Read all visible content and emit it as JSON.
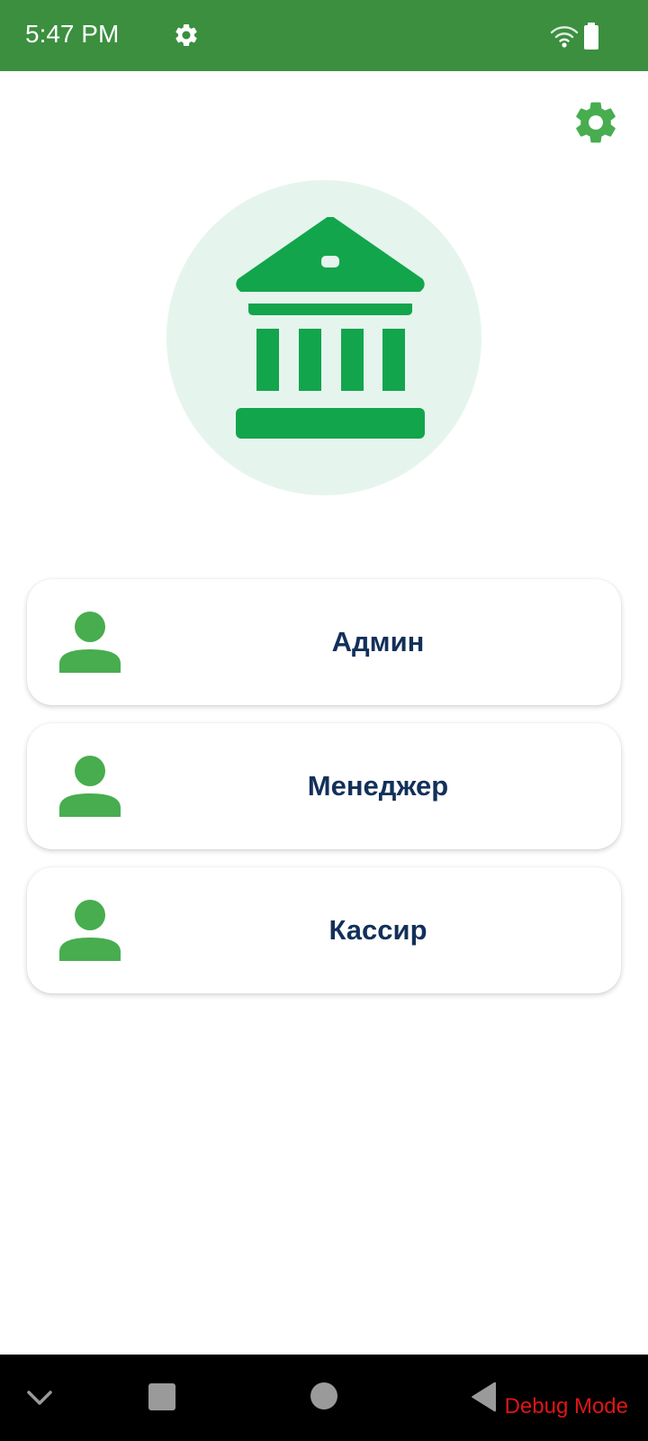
{
  "status_bar": {
    "time": "5:47 PM",
    "background": "#3b8f3f",
    "icons": [
      "gear-icon",
      "wifi-icon",
      "battery-icon"
    ]
  },
  "header": {
    "settings_icon": "gear-icon",
    "accent": "#47ad4f"
  },
  "logo": {
    "icon": "bank-icon",
    "color": "#13a54c",
    "circle_color": "#e5f5ed"
  },
  "roles": [
    {
      "label": "Админ",
      "icon": "person-icon"
    },
    {
      "label": "Менеджер",
      "icon": "person-icon"
    },
    {
      "label": "Кассир",
      "icon": "person-icon"
    }
  ],
  "role_text_color": "#12305a",
  "nav_bar": {
    "icons": [
      "chevron-down-icon",
      "recents-icon",
      "home-icon",
      "back-icon"
    ],
    "debug_label": "Debug Mode",
    "debug_color": "#e01515"
  }
}
